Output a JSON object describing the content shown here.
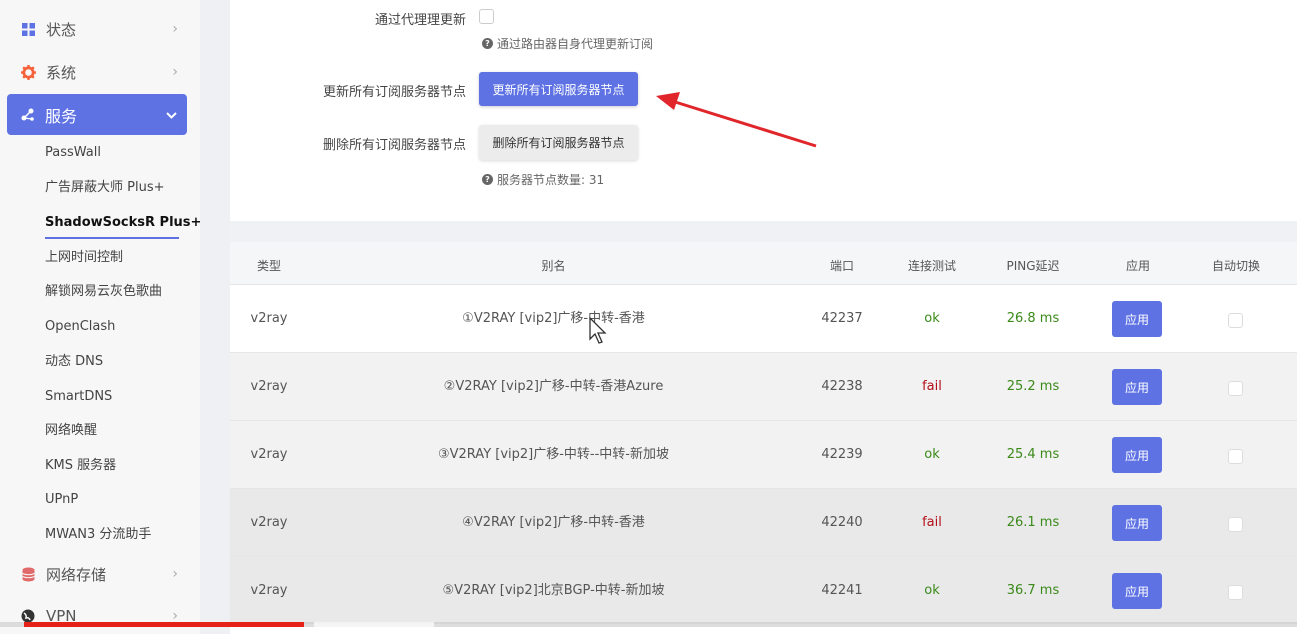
{
  "sidebar": {
    "status": {
      "label": "状态",
      "icon": "dashboard-icon"
    },
    "system": {
      "label": "系统",
      "icon": "gear-icon"
    },
    "services": {
      "label": "服务",
      "icon": "share-icon"
    },
    "submenu": [
      {
        "label": "PassWall"
      },
      {
        "label": "广告屏蔽大师 Plus+"
      },
      {
        "label": "ShadowSocksR Plus+"
      },
      {
        "label": "上网时间控制"
      },
      {
        "label": "解锁网易云灰色歌曲"
      },
      {
        "label": "OpenClash"
      },
      {
        "label": "动态 DNS"
      },
      {
        "label": "SmartDNS"
      },
      {
        "label": "网络唤醒"
      },
      {
        "label": "KMS 服务器"
      },
      {
        "label": "UPnP"
      },
      {
        "label": "MWAN3 分流助手"
      }
    ],
    "storage": {
      "label": "网络存储",
      "icon": "database-icon"
    },
    "vpn": {
      "label": "VPN",
      "icon": "globe-icon"
    }
  },
  "form": {
    "proxy_update_label": "通过代理理更新",
    "proxy_update_hint": "通过路由器自身代理更新订阅",
    "update_all_label": "更新所有订阅服务器节点",
    "update_all_button": "更新所有订阅服务器节点",
    "delete_all_label": "删除所有订阅服务器节点",
    "delete_all_button": "删除所有订阅服务器节点",
    "node_count_hint": "服务器节点数量: 31"
  },
  "table": {
    "headers": {
      "type": "类型",
      "alias": "别名",
      "port": "端口",
      "test": "连接测试",
      "ping": "PING延迟",
      "apply": "应用",
      "auto": "自动切换"
    },
    "rows": [
      {
        "type": "v2ray",
        "alias": "①V2RAY [vip2]广移-中转-香港",
        "port": "42237",
        "test": "ok",
        "ping": "26.8 ms",
        "apply": "应用"
      },
      {
        "type": "v2ray",
        "alias": "②V2RAY [vip2]广移-中转-香港Azure",
        "port": "42238",
        "test": "fail",
        "ping": "25.2 ms",
        "apply": "应用"
      },
      {
        "type": "v2ray",
        "alias": "③V2RAY [vip2]广移-中转--中转-新加坡",
        "port": "42239",
        "test": "ok",
        "ping": "25.4 ms",
        "apply": "应用"
      },
      {
        "type": "v2ray",
        "alias": "④V2RAY [vip2]广移-中转-香港",
        "port": "42240",
        "test": "fail",
        "ping": "26.1 ms",
        "apply": "应用"
      },
      {
        "type": "v2ray",
        "alias": "⑤V2RAY [vip2]北京BGP-中转-新加坡",
        "port": "42241",
        "test": "ok",
        "ping": "36.7 ms",
        "apply": "应用"
      }
    ]
  },
  "video": {
    "played_fraction": 0.22
  }
}
